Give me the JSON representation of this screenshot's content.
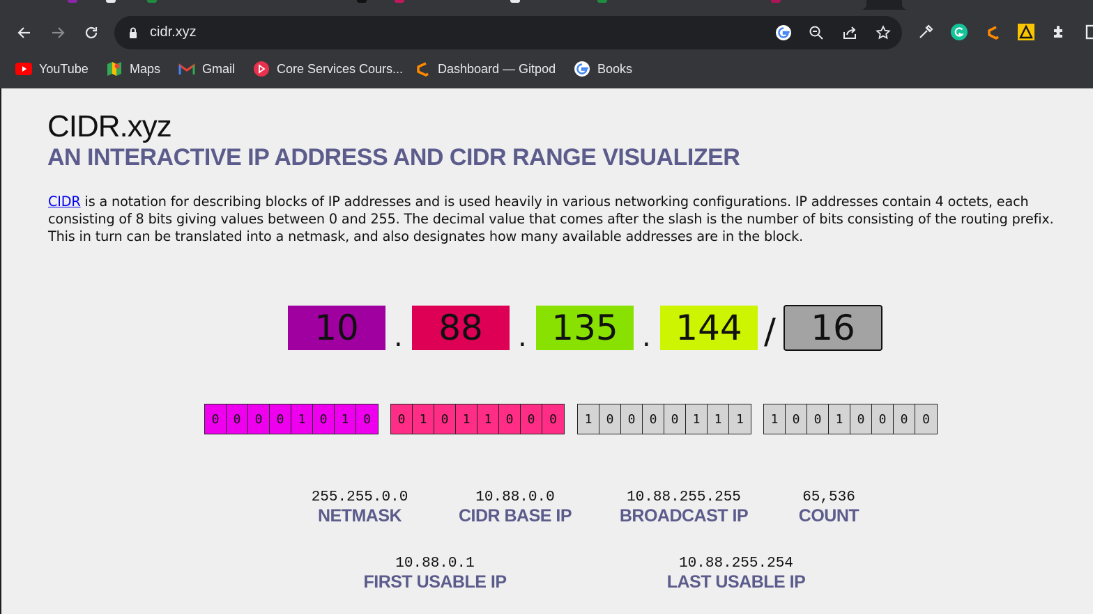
{
  "browser": {
    "url": "cidr.xyz",
    "bookmarks": [
      {
        "label": "YouTube",
        "icon": "youtube-icon"
      },
      {
        "label": "Maps",
        "icon": "maps-icon"
      },
      {
        "label": "Gmail",
        "icon": "gmail-icon"
      },
      {
        "label": "Core Services Cours...",
        "icon": "play-circle-icon"
      },
      {
        "label": "Dashboard — Gitpod",
        "icon": "gitpod-icon"
      },
      {
        "label": "Books",
        "icon": "google-icon"
      }
    ]
  },
  "page": {
    "title": "CIDR.xyz",
    "subtitle": "AN INTERACTIVE IP ADDRESS AND CIDR RANGE VISUALIZER",
    "intro_link": "CIDR",
    "intro_text": " is a notation for describing blocks of IP addresses and is used heavily in various networking configurations. IP addresses contain 4 octets, each consisting of 8 bits giving values between 0 and 255. The decimal value that comes after the slash is the number of bits consisting of the routing prefix. This in turn can be translated into a netmask, and also designates how many available addresses are in the block."
  },
  "ip": {
    "octets": [
      "10",
      "88",
      "135",
      "144"
    ],
    "separator": ".",
    "slash": "/",
    "prefix": "16",
    "octet_colors": [
      "#a100a1",
      "#dd0055",
      "#88e100",
      "#cdf400"
    ],
    "bits": [
      [
        "0",
        "0",
        "0",
        "0",
        "1",
        "0",
        "1",
        "0"
      ],
      [
        "0",
        "1",
        "0",
        "1",
        "1",
        "0",
        "0",
        "0"
      ],
      [
        "1",
        "0",
        "0",
        "0",
        "0",
        "1",
        "1",
        "1"
      ],
      [
        "1",
        "0",
        "0",
        "1",
        "0",
        "0",
        "0",
        "0"
      ]
    ],
    "bit_colors": [
      "#ee00ee",
      "#ff2d86",
      "#d4d4d4",
      "#d4d4d4"
    ]
  },
  "results": {
    "netmask": {
      "value": "255.255.0.0",
      "label": "NETMASK"
    },
    "base_ip": {
      "value": "10.88.0.0",
      "label": "CIDR BASE IP"
    },
    "broadcast": {
      "value": "10.88.255.255",
      "label": "BROADCAST IP"
    },
    "count": {
      "value": "65,536",
      "label": "COUNT"
    },
    "first_usable": {
      "value": "10.88.0.1",
      "label": "FIRST USABLE IP"
    },
    "last_usable": {
      "value": "10.88.255.254",
      "label": "LAST USABLE IP"
    }
  }
}
